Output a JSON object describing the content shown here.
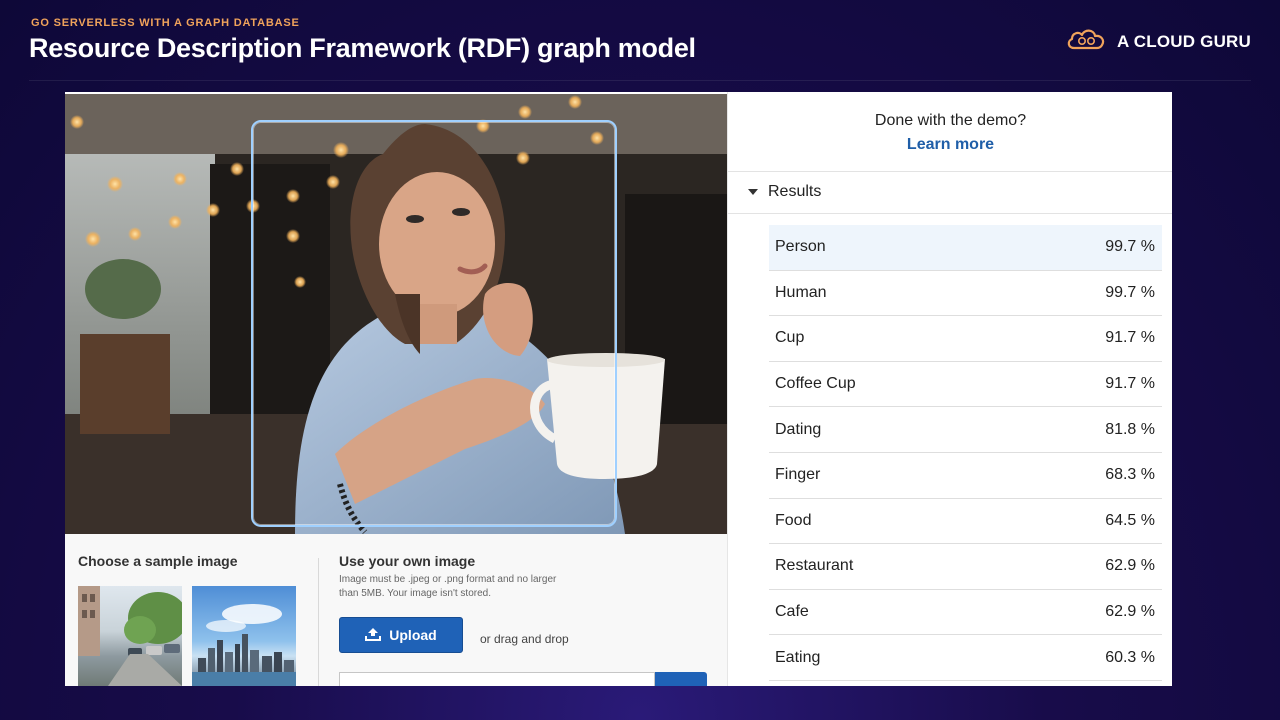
{
  "slide": {
    "eyebrow": "GO SERVERLESS WITH A GRAPH DATABASE",
    "title": "Resource Description Framework (RDF) graph model",
    "brand": "A CLOUD GURU",
    "brand_icon": "cloud-icon",
    "accent_color": "#f0a35b"
  },
  "demo": {
    "sample_heading": "Choose a sample image",
    "own_heading": "Use your own image",
    "own_hint": "Image must be .jpeg or .png format and no larger than 5MB. Your image isn't stored.",
    "upload_label": "Upload",
    "upload_icon": "upload-icon",
    "drag_text": "or drag and drop",
    "button_color": "#1f62b7"
  },
  "panel": {
    "done_text": "Done with the demo?",
    "learn_more": "Learn more",
    "results_label": "Results",
    "link_color": "#1f5ea8",
    "results": [
      {
        "label": "Person",
        "confidence": "99.7 %"
      },
      {
        "label": "Human",
        "confidence": "99.7 %"
      },
      {
        "label": "Cup",
        "confidence": "91.7 %"
      },
      {
        "label": "Coffee Cup",
        "confidence": "91.7 %"
      },
      {
        "label": "Dating",
        "confidence": "81.8 %"
      },
      {
        "label": "Finger",
        "confidence": "68.3 %"
      },
      {
        "label": "Food",
        "confidence": "64.5 %"
      },
      {
        "label": "Restaurant",
        "confidence": "62.9 %"
      },
      {
        "label": "Cafe",
        "confidence": "62.9 %"
      },
      {
        "label": "Eating",
        "confidence": "60.3 %"
      }
    ]
  }
}
